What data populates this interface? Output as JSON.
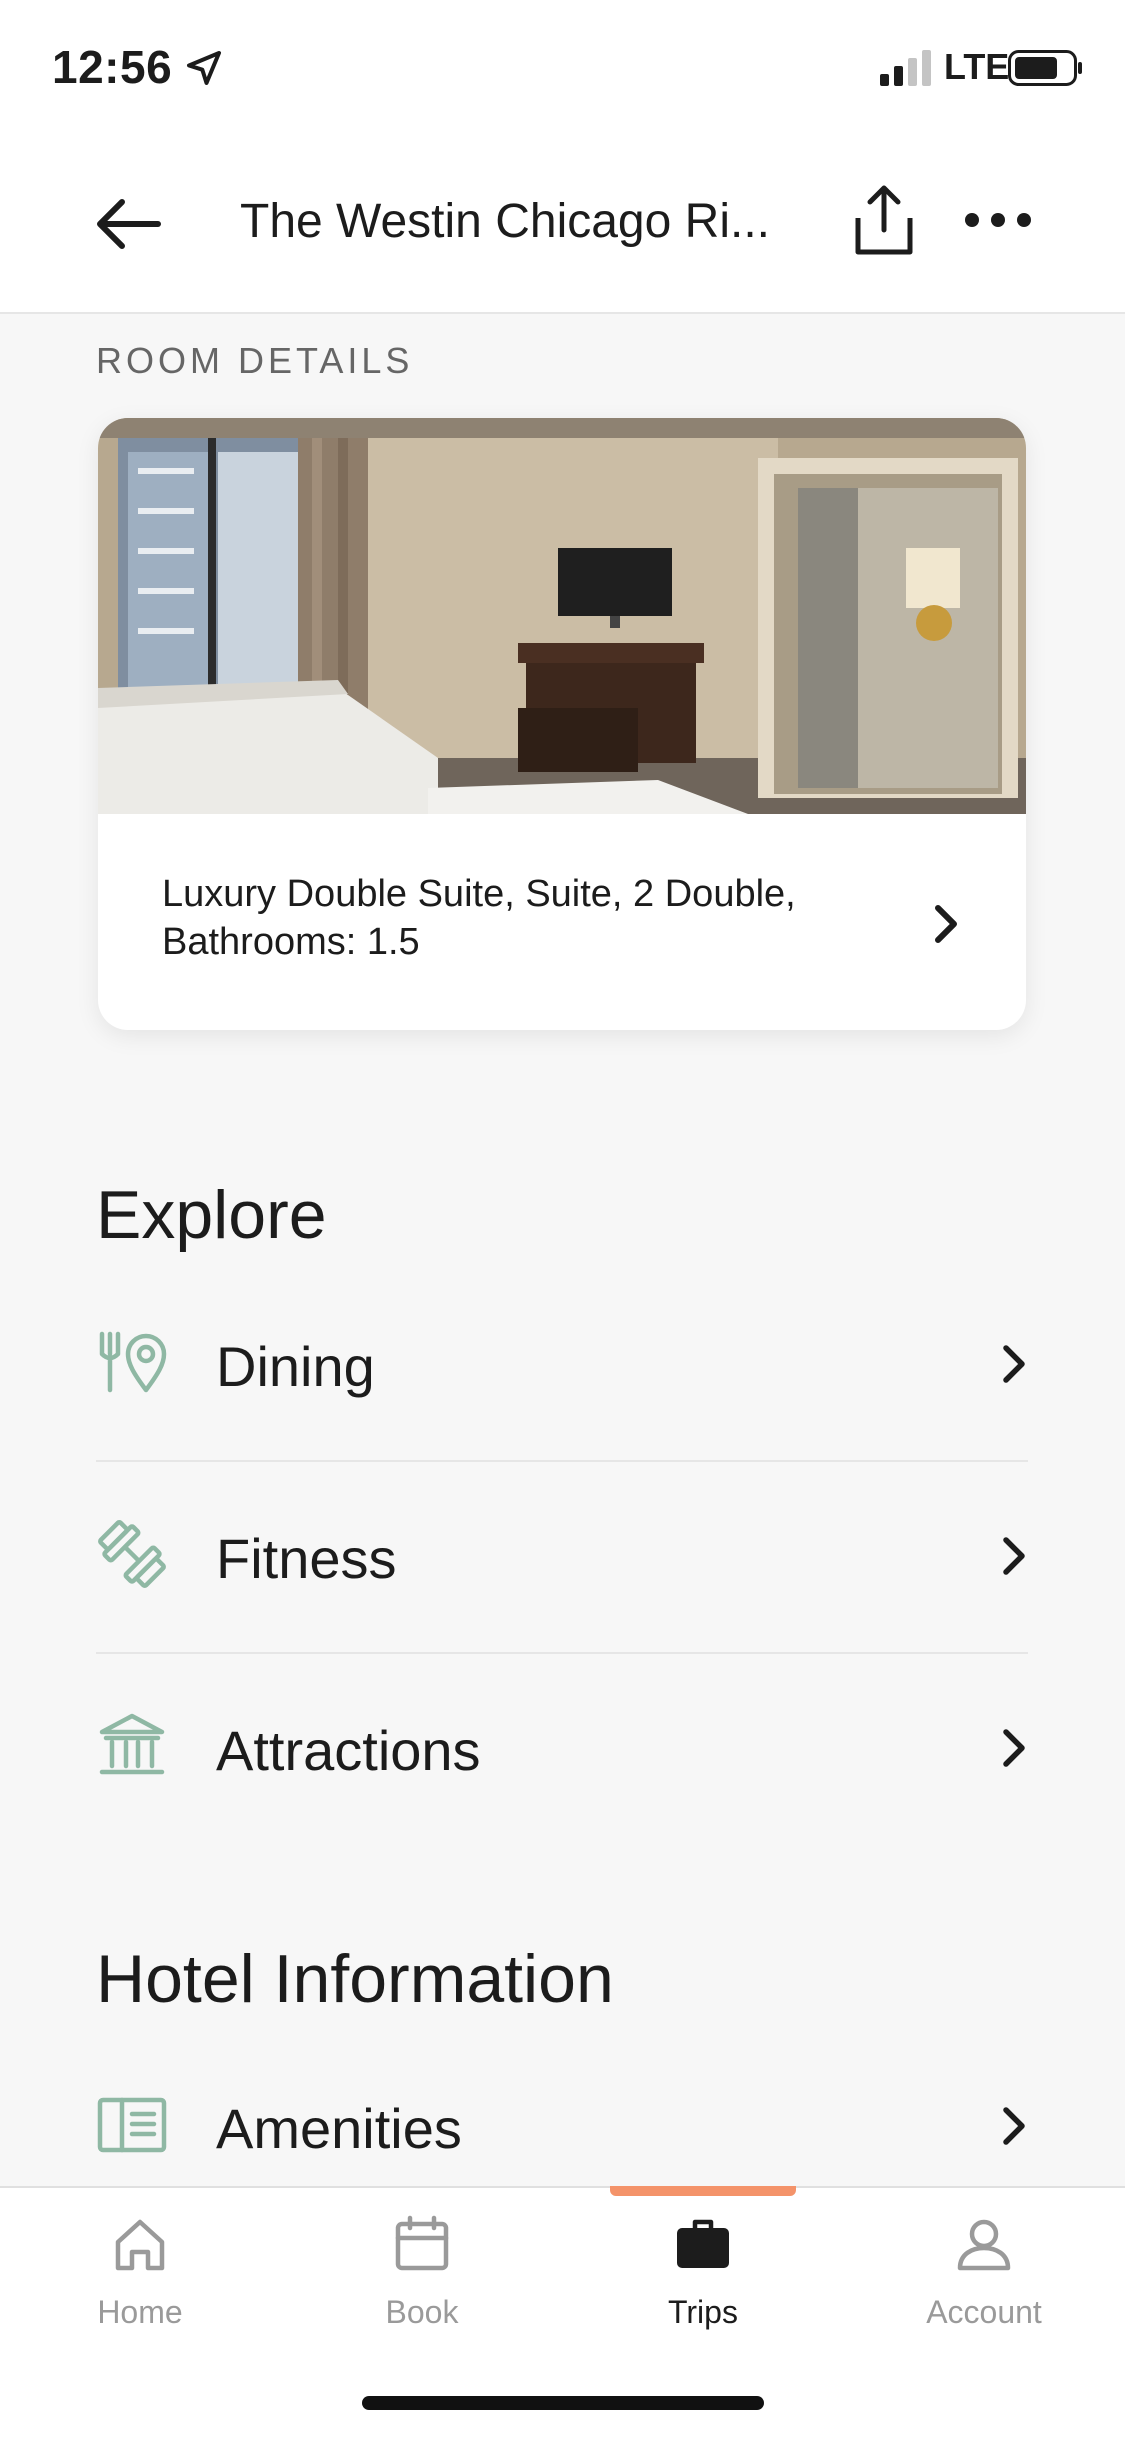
{
  "status_bar": {
    "time": "12:56",
    "network": "LTE",
    "icons": [
      "location-arrow-icon",
      "signal-bars-icon",
      "battery-icon"
    ]
  },
  "header": {
    "title": "The Westin Chicago Ri...",
    "back_icon": "arrow-left-icon",
    "share_icon": "share-icon",
    "more_icon": "ellipsis-icon"
  },
  "room_details": {
    "section_label": "ROOM DETAILS",
    "photo": "hotel-room-photo",
    "description": "Luxury Double Suite, Suite, 2 Double, Bathrooms: 1.5"
  },
  "explore": {
    "heading": "Explore",
    "items": [
      {
        "label": "Dining",
        "icon": "dining-location-icon"
      },
      {
        "label": "Fitness",
        "icon": "dumbbell-icon"
      },
      {
        "label": "Attractions",
        "icon": "museum-icon"
      }
    ]
  },
  "hotel_information": {
    "heading": "Hotel Information",
    "items": [
      {
        "label": "Amenities",
        "icon": "book-icon"
      }
    ]
  },
  "tab_bar": {
    "tabs": [
      {
        "label": "Home",
        "icon": "home-icon"
      },
      {
        "label": "Book",
        "icon": "calendar-icon"
      },
      {
        "label": "Trips",
        "icon": "briefcase-icon"
      },
      {
        "label": "Account",
        "icon": "user-icon"
      }
    ],
    "active": "Trips"
  },
  "colors": {
    "accent_green": "#8fb8a4",
    "active_tab_indicator": "#f4936a",
    "background": "#f7f7f7",
    "text": "#1c1c1c",
    "muted": "#9a9a9a"
  }
}
